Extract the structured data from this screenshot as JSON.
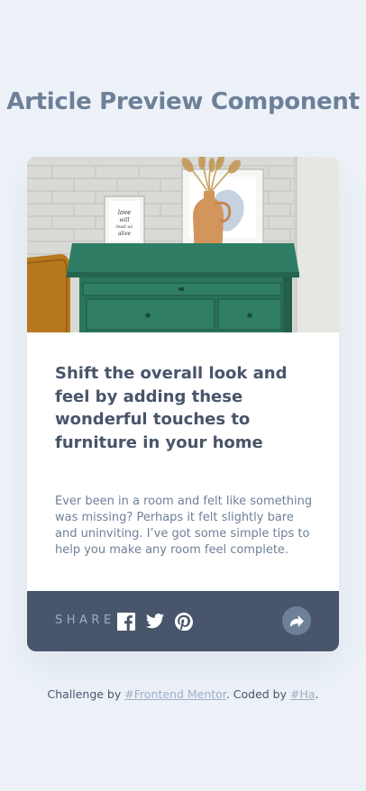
{
  "page": {
    "title": "Article Preview Component"
  },
  "article": {
    "image_alt": "drawers",
    "headline": "Shift the overall look and feel by adding these wonderful touches to furniture in your home",
    "excerpt": "Ever been in a room and felt like something was missing? Perhaps it felt slightly bare and uninviting. I’ve got some simple tips to help you make any room feel complete.",
    "frame_text": "love will lead us alive"
  },
  "share": {
    "label": "SHARE",
    "icons": [
      "facebook-icon",
      "twitter-icon",
      "pinterest-icon"
    ],
    "button_icon": "share-arrow-icon"
  },
  "footer": {
    "prefix": "Challenge by ",
    "link1": "#Frontend Mentor",
    "middle": ". Coded by ",
    "link2": "#Ha",
    "suffix": "."
  },
  "colors": {
    "background": "#ecf2f8",
    "title": "#6e8098",
    "headline": "#48556a",
    "share_bar": "#48556a",
    "share_label": "#9eafc2",
    "share_button": "#6e8098",
    "drawer_green": "#2e7d64"
  }
}
